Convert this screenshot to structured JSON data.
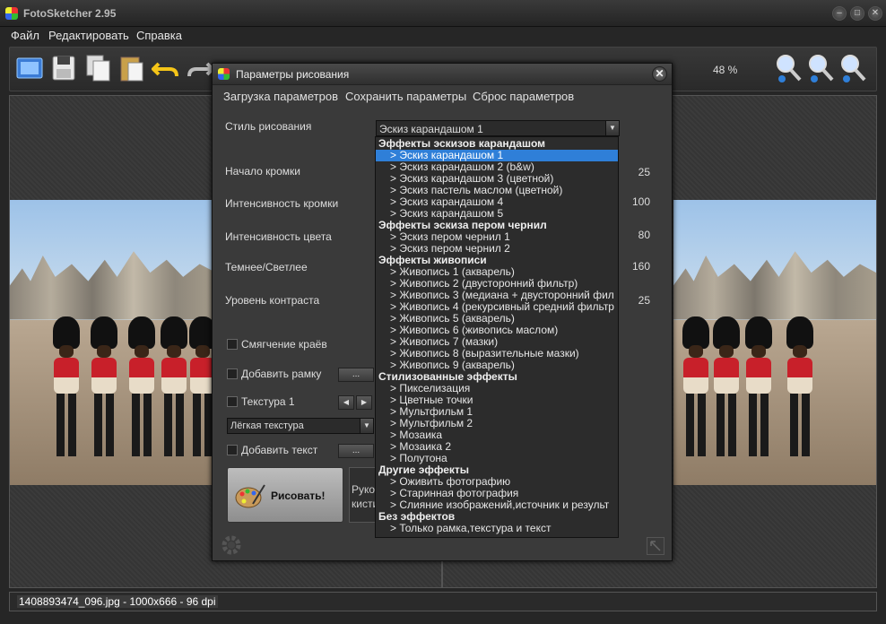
{
  "window": {
    "title": "FotoSketcher 2.95",
    "min": "–",
    "max": "□",
    "close": "✕"
  },
  "menu": [
    "Файл",
    "Редактировать",
    "Справка"
  ],
  "toolbar": {
    "zoom": "48 %"
  },
  "status": {
    "file_info": "1408893474_096.jpg - 1000x666 - 96 dpi"
  },
  "dialog": {
    "title": "Параметры рисования",
    "close": "✕",
    "menu": [
      "Загрузка параметров",
      "Сохранить параметры",
      "Сброс параметров"
    ],
    "style_label": "Стиль рисования",
    "style_value": "Эскиз карандашом 1",
    "params": [
      {
        "label": "Начало кромки",
        "value": "25"
      },
      {
        "label": "Интенсивность кромки",
        "value": "100"
      },
      {
        "label": "Интенсивность цвета",
        "value": "80"
      },
      {
        "label": "Темнее/Светлее",
        "value": "160"
      },
      {
        "label": "Уровень контраста",
        "value": "25"
      }
    ],
    "soften_edges": "Смягчение краёв",
    "add_frame": "Добавить рамку",
    "texture": "Текстура 1",
    "texture_type": "Лёгкая текстура",
    "add_text": "Добавить текст",
    "dots": "...",
    "draw_button": "Рисовать!",
    "brush_line1": "Руков",
    "brush_line2": "кисти"
  },
  "dropdown": [
    {
      "type": "head",
      "text": "Эффекты эскизов карандашом"
    },
    {
      "type": "item",
      "text": ">   Эскиз карандашом 1",
      "selected": true
    },
    {
      "type": "item",
      "text": ">   Эскиз карандашом 2 (b&w)"
    },
    {
      "type": "item",
      "text": ">   Эскиз карандашом 3 (цветной)"
    },
    {
      "type": "item",
      "text": ">   Эскиз пастель маслом (цветной)"
    },
    {
      "type": "item",
      "text": ">   Эскиз карандашом 4"
    },
    {
      "type": "item",
      "text": ">   Эскиз карандашом 5"
    },
    {
      "type": "head",
      "text": "Эффекты эскиза пером чернил"
    },
    {
      "type": "item",
      "text": ">   Эскиз пером чернил 1"
    },
    {
      "type": "item",
      "text": ">   Эскиз пером чернил 2"
    },
    {
      "type": "head",
      "text": "Эффекты живописи"
    },
    {
      "type": "item",
      "text": ">   Живопись 1 (акварель)"
    },
    {
      "type": "item",
      "text": ">   Живопись 2 (двусторонний фильтр)"
    },
    {
      "type": "item",
      "text": ">   Живопись 3 (медиана + двусторонний фил"
    },
    {
      "type": "item",
      "text": ">   Живопись 4 (рекурсивный средний фильтр"
    },
    {
      "type": "item",
      "text": ">   Живопись 5 (акварель)"
    },
    {
      "type": "item",
      "text": ">   Живопись 6 (живопись маслом)"
    },
    {
      "type": "item",
      "text": ">   Живопись 7 (мазки)"
    },
    {
      "type": "item",
      "text": ">   Живопись 8 (выразительные мазки)"
    },
    {
      "type": "item",
      "text": ">   Живопись 9 (акварель)"
    },
    {
      "type": "head",
      "text": "Стилизованные эффекты"
    },
    {
      "type": "item",
      "text": ">   Пикселизация"
    },
    {
      "type": "item",
      "text": ">   Цветные точки"
    },
    {
      "type": "item",
      "text": ">   Мультфильм 1"
    },
    {
      "type": "item",
      "text": ">   Мультфильм 2"
    },
    {
      "type": "item",
      "text": ">   Мозаика"
    },
    {
      "type": "item",
      "text": ">   Мозаика 2"
    },
    {
      "type": "item",
      "text": ">   Полутона"
    },
    {
      "type": "head",
      "text": "Другие эффекты"
    },
    {
      "type": "item",
      "text": ">   Оживить фотографию"
    },
    {
      "type": "item",
      "text": ">   Старинная фотография"
    },
    {
      "type": "item",
      "text": ">   Слияние изображений,источник и результ"
    },
    {
      "type": "head",
      "text": "Без эффектов"
    },
    {
      "type": "item",
      "text": ">   Только рамка,текстура и текст"
    }
  ]
}
